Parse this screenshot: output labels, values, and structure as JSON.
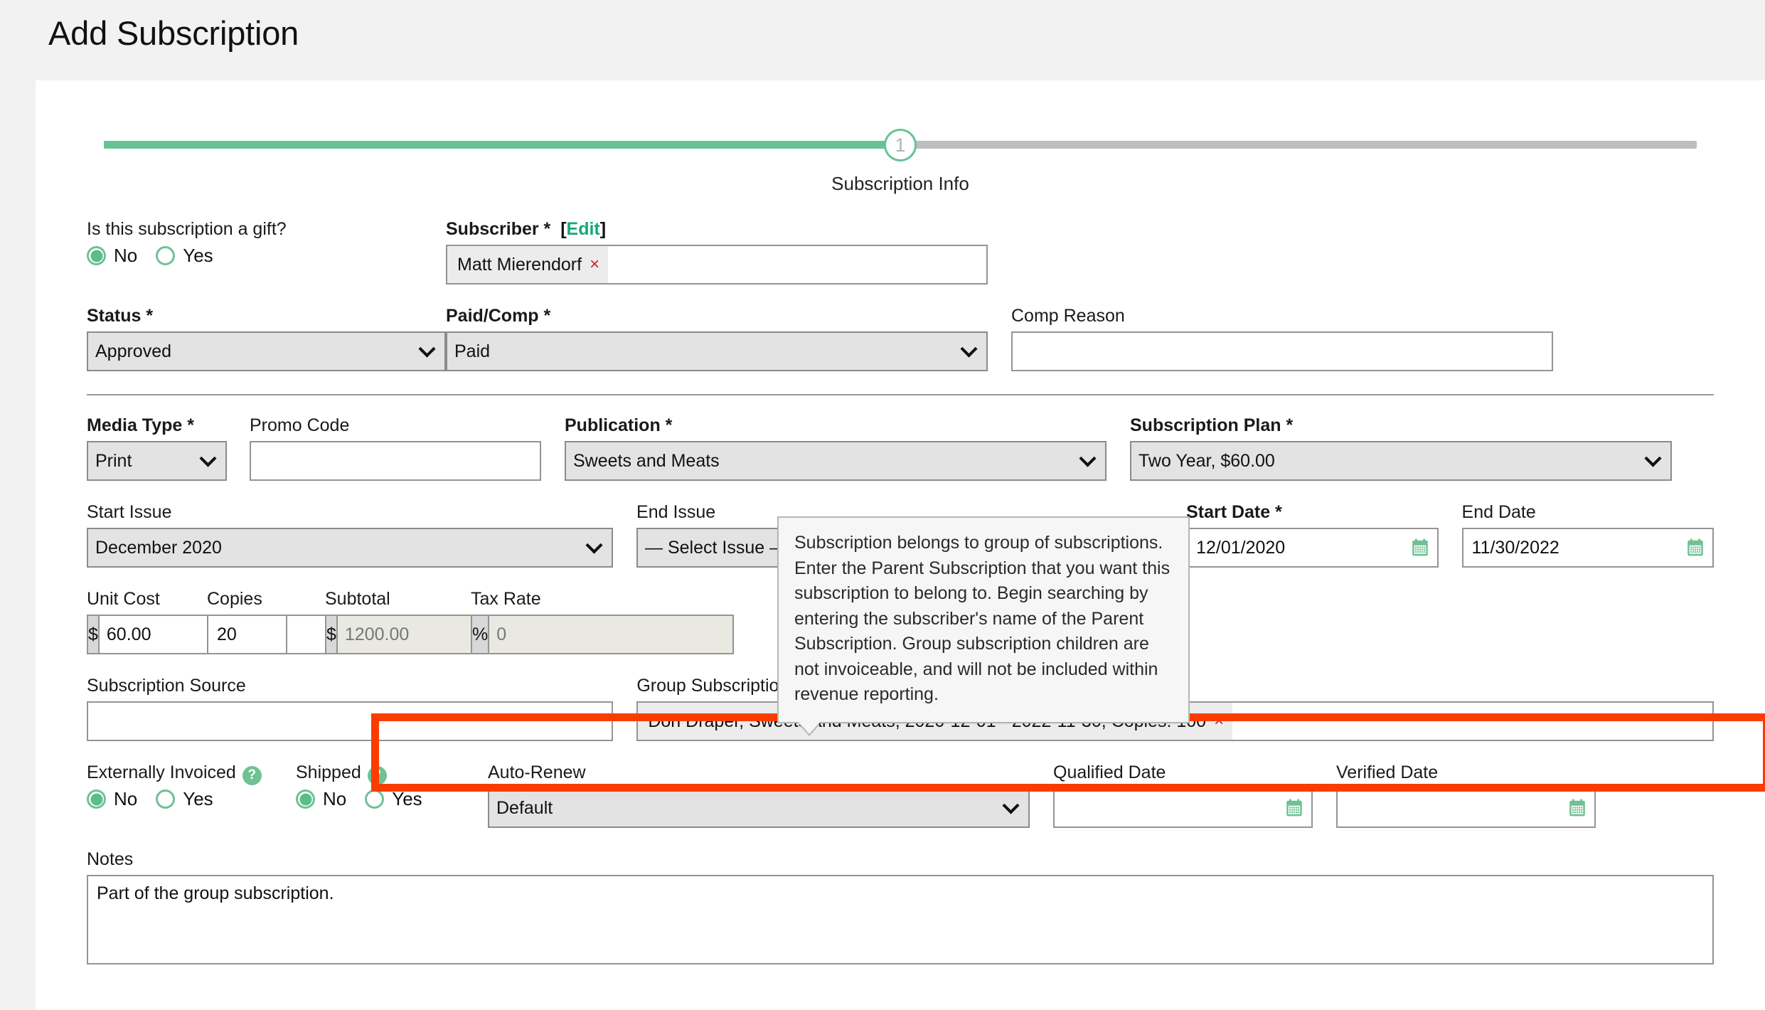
{
  "page": {
    "title": "Add Subscription"
  },
  "stepper": {
    "number": "1",
    "label": "Subscription Info"
  },
  "fields": {
    "gift": {
      "label": "Is this subscription a gift?",
      "options": [
        "No",
        "Yes"
      ],
      "selected": "No"
    },
    "subscriber": {
      "label": "Subscriber *",
      "edit_link": "Edit",
      "bracket_open": "[",
      "bracket_close": "]",
      "token": "Matt Mierendorf",
      "remove": "×"
    },
    "status": {
      "label": "Status *",
      "value": "Approved",
      "options": [
        "Approved"
      ]
    },
    "paid_comp": {
      "label": "Paid/Comp *",
      "value": "Paid",
      "options": [
        "Paid"
      ]
    },
    "comp_reason": {
      "label": "Comp Reason",
      "value": ""
    },
    "media_type": {
      "label": "Media Type *",
      "value": "Print",
      "options": [
        "Print"
      ]
    },
    "promo_code": {
      "label": "Promo Code",
      "value": ""
    },
    "publication": {
      "label": "Publication *",
      "value": "Sweets and Meats",
      "options": [
        "Sweets and Meats"
      ]
    },
    "subscription_plan": {
      "label": "Subscription Plan *",
      "value": "Two Year, $60.00",
      "options": [
        "Two Year, $60.00"
      ]
    },
    "start_issue": {
      "label": "Start Issue",
      "value": "December 2020",
      "options": [
        "December 2020"
      ]
    },
    "end_issue": {
      "label": "End Issue",
      "value": "— Select Issue —",
      "options": [
        "— Select Issue —"
      ]
    },
    "start_date": {
      "label": "Start Date *",
      "value": "12/01/2020"
    },
    "end_date": {
      "label": "End Date",
      "value": "11/30/2022"
    },
    "unit_cost": {
      "label": "Unit Cost",
      "prefix": "$",
      "value": "60.00"
    },
    "copies": {
      "label": "Copies",
      "value": "20"
    },
    "subtotal": {
      "label": "Subtotal",
      "prefix": "$",
      "value": "1200.00"
    },
    "tax_rate": {
      "label": "Tax Rate",
      "prefix": "%",
      "value": "0"
    },
    "subscription_source": {
      "label": "Subscription Source",
      "value": ""
    },
    "group_subscription": {
      "label": "Group Subscription",
      "help_icon": "help-icon",
      "token": "Don Draper, Sweets and Meats, 2020-12-01 - 2022-11-30, Copies: 100",
      "remove": "×"
    },
    "externally_invoiced": {
      "label": "Externally Invoiced",
      "options": [
        "No",
        "Yes"
      ],
      "selected": "No"
    },
    "shipped": {
      "label": "Shipped",
      "options": [
        "No",
        "Yes"
      ],
      "selected": "No"
    },
    "auto_renew": {
      "label": "Auto-Renew",
      "value": "Default",
      "options": [
        "Default"
      ]
    },
    "qualified_date": {
      "label": "Qualified Date",
      "value": ""
    },
    "verified_date": {
      "label": "Verified Date",
      "value": ""
    },
    "notes": {
      "label": "Notes",
      "value": "Part of the group subscription."
    }
  },
  "tooltip": {
    "text": "Subscription belongs to group of subscriptions. Enter the Parent Subscription that you want this subscription to belong to. Begin searching by entering the subscriber's name of the Parent Subscription. Group subscription children are not invoiceable, and will not be included within revenue reporting."
  },
  "colors": {
    "accent_green": "#67c396",
    "link_green": "#17a67a",
    "highlight_red": "#fa3c00",
    "remove_red": "#c0272d"
  }
}
